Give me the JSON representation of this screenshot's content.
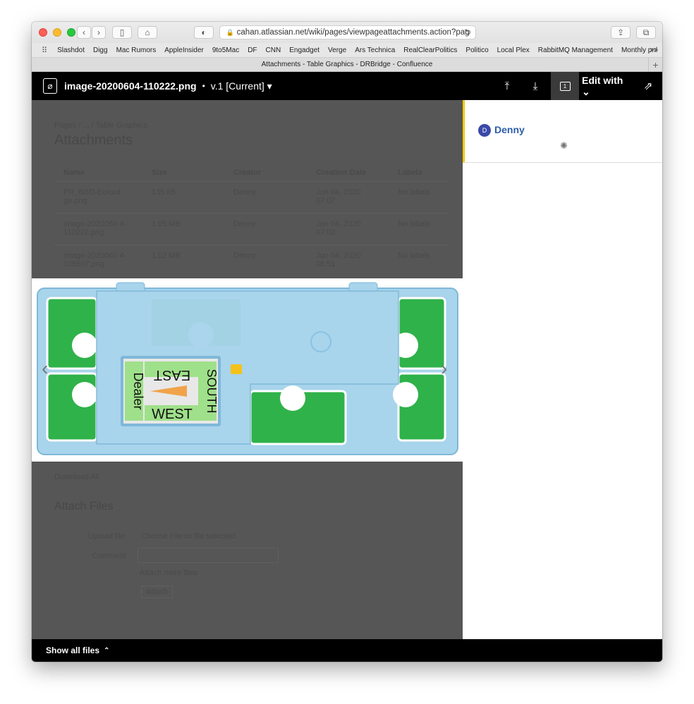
{
  "browser": {
    "url": "cahan.atlassian.net/wiki/pages/viewpageattachments.action?pag",
    "tab_title": "Attachments - Table Graphics - DRBridge - Confluence",
    "bookmarks": [
      "Slashdot",
      "Digg",
      "Mac Rumors",
      "AppleInsider",
      "9to5Mac",
      "DF",
      "CNN",
      "Engadget",
      "Verge",
      "Ars Technica",
      "RealClearPolitics",
      "Politico",
      "Local Plex",
      "RabbitMQ Management",
      "Monthly pnl"
    ],
    "more": ">>"
  },
  "viewer": {
    "file_name": "image-20200604-110222.png",
    "separator": "•",
    "version": "v.1 [Current] ▾",
    "comment_count": "1",
    "edit_with": "Edit with ⌄"
  },
  "background_page": {
    "breadcrumb": "Pages / ... / Table Graphics",
    "title": "Attachments",
    "columns": [
      "Name",
      "Size",
      "Creator",
      "Creation Date",
      "Labels"
    ],
    "rows": [
      {
        "name": "PR_BBD-Eurord ge.png",
        "size": "135 kB",
        "creator": "Denny",
        "date": "Jun 04, 2020 07:07",
        "labels": "No labels"
      },
      {
        "name": "image-2020060 4-110222.png",
        "size": "1.05 MB",
        "creator": "Denny",
        "date": "Jun 04, 2020 07:02",
        "labels": "No labels"
      },
      {
        "name": "image-2020060 4-105507.png",
        "size": "1.02 MB",
        "creator": "Denny",
        "date": "Jun 04, 2020 06:51",
        "labels": "No labels"
      }
    ],
    "download_all": "Download All",
    "attach_title": "Attach Files",
    "upload_label": "Upload file",
    "choose_file": "Choose File",
    "no_file": "no file selected",
    "comment_label": "Comment",
    "attach_more": "Attach more files",
    "attach_button": "Attach"
  },
  "image": {
    "card_labels": {
      "east": "EAST",
      "south": "SOUTH",
      "west": "WEST",
      "dealer": "Dealer"
    }
  },
  "comment": {
    "avatar_initial": "D",
    "author": "Denny"
  },
  "footer": {
    "show_all": "Show all files"
  },
  "colors": {
    "tray_blue": "#a8d4ec",
    "card_green": "#2fb24a",
    "accent_yellow": "#f0cb00",
    "author_blue": "#2c5ea8"
  }
}
